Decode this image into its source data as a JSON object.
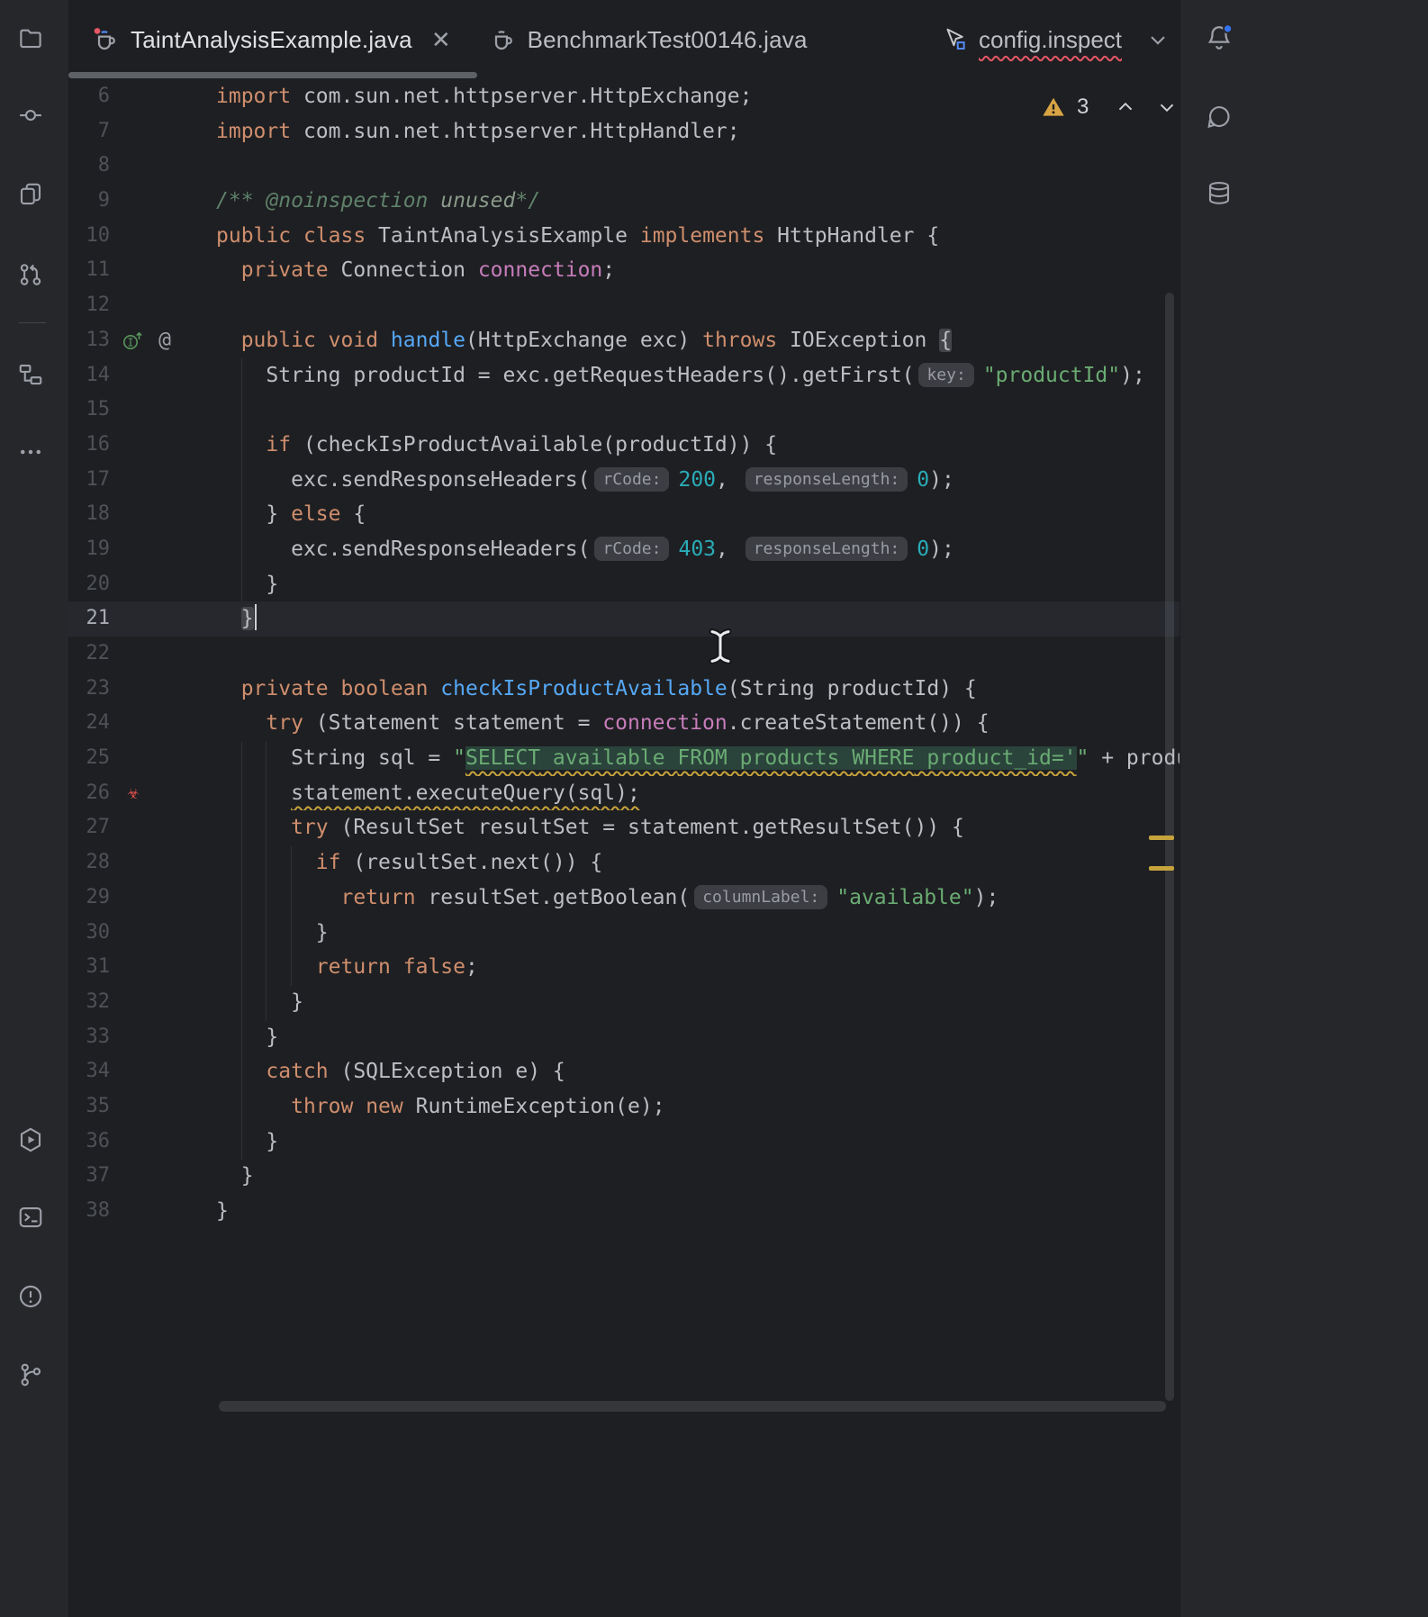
{
  "colors": {
    "editor_bg": "#1E1F22",
    "stripe_bg": "#26272B",
    "accent_blue": "#3574F0",
    "warning_yellow": "#D8A444",
    "error_red": "#E55765",
    "keyword_orange": "#CF8E6D",
    "string_green": "#6AAB73",
    "number_teal": "#2AACB8",
    "method_blue": "#56A8F5",
    "field_purple": "#C77DBB",
    "comment_green": "#5F826B",
    "sql_injection_bg": "#396F5C",
    "current_line_bg": "#26282E"
  },
  "left_stripe": {
    "top_icons": [
      {
        "name": "project-folder"
      },
      {
        "name": "commit"
      },
      {
        "name": "copy-pages"
      },
      {
        "name": "pull-requests"
      },
      {
        "name": "structure"
      },
      {
        "name": "more-tools"
      }
    ],
    "bottom_icons": [
      {
        "name": "run-services"
      },
      {
        "name": "terminal"
      },
      {
        "name": "problems"
      },
      {
        "name": "git-branch"
      }
    ]
  },
  "right_stripe": {
    "icons": [
      {
        "name": "notifications-bell",
        "has_new": true
      },
      {
        "name": "ai-assistant"
      },
      {
        "name": "database"
      }
    ]
  },
  "tab_bar": {
    "tabs": [
      {
        "title": "TaintAnalysisExample.java",
        "active": true,
        "icon": "java-file",
        "close_glyph": "✕"
      },
      {
        "title": "BenchmarkTest00146.java",
        "active": false,
        "icon": "java-file"
      }
    ],
    "overflow": {
      "icon": "inspection-config-file",
      "title": "config.inspect",
      "has_error_underline": true
    }
  },
  "inspection_widget": {
    "warning_count": "3",
    "icons": [
      "warning-triangle",
      "chevron-up",
      "chevron-down"
    ]
  },
  "editor": {
    "first_line": 6,
    "last_line": 38,
    "current_line": 21,
    "lines": [
      {
        "n": 6,
        "ind": 0,
        "tk": [
          [
            "kw",
            "import"
          ],
          [
            "pl",
            " com.sun.net.httpserver.HttpExchange;"
          ]
        ]
      },
      {
        "n": 7,
        "ind": 0,
        "tk": [
          [
            "kw",
            "import"
          ],
          [
            "pl",
            " com.sun.net.httpserver.HttpHandler;"
          ]
        ]
      },
      {
        "n": 8,
        "ind": 0,
        "tk": []
      },
      {
        "n": 9,
        "ind": 0,
        "tk": [
          [
            "doc",
            "/** @noinspection "
          ],
          [
            "docv",
            "unused"
          ],
          [
            "doc",
            "*/"
          ]
        ]
      },
      {
        "n": 10,
        "ind": 0,
        "tk": [
          [
            "kw",
            "public"
          ],
          [
            "pl",
            " "
          ],
          [
            "kw",
            "class"
          ],
          [
            "pl",
            " TaintAnalysisExample "
          ],
          [
            "kw",
            "implements"
          ],
          [
            "pl",
            " HttpHandler {"
          ]
        ]
      },
      {
        "n": 11,
        "ind": 2,
        "tk": [
          [
            "kw",
            "private"
          ],
          [
            "pl",
            " Connection "
          ],
          [
            "fld",
            "connection"
          ],
          [
            "pl",
            ";"
          ]
        ]
      },
      {
        "n": 12,
        "ind": 0,
        "tk": []
      },
      {
        "n": 13,
        "ind": 2,
        "g": [
          "impl",
          "at"
        ],
        "tk": [
          [
            "kw",
            "public"
          ],
          [
            "pl",
            " "
          ],
          [
            "kw",
            "void"
          ],
          [
            "pl",
            " "
          ],
          [
            "mth",
            "handle"
          ],
          [
            "pl",
            "(HttpExchange exc) "
          ],
          [
            "kw",
            "throws"
          ],
          [
            "pl",
            " IOException "
          ],
          [
            "pl",
            "{",
            "bm"
          ]
        ]
      },
      {
        "n": 14,
        "ind": 4,
        "tk": [
          [
            "pl",
            "String productId = exc.getRequestHeaders().getFirst("
          ],
          [
            "inlay",
            "key:"
          ],
          [
            "str",
            "\"productId\""
          ],
          [
            "pl",
            ");"
          ]
        ]
      },
      {
        "n": 15,
        "ind": 0,
        "tk": []
      },
      {
        "n": 16,
        "ind": 4,
        "tk": [
          [
            "kw",
            "if"
          ],
          [
            "pl",
            " (checkIsProductAvailable(productId)) {"
          ]
        ]
      },
      {
        "n": 17,
        "ind": 6,
        "tk": [
          [
            "pl",
            "exc.sendResponseHeaders("
          ],
          [
            "inlay",
            "rCode:"
          ],
          [
            "num",
            "200"
          ],
          [
            "pl",
            ", "
          ],
          [
            "inlay",
            "responseLength:"
          ],
          [
            "num",
            "0"
          ],
          [
            "pl",
            ");"
          ]
        ]
      },
      {
        "n": 18,
        "ind": 4,
        "tk": [
          [
            "pl",
            "} "
          ],
          [
            "kw",
            "else"
          ],
          [
            "pl",
            " {"
          ]
        ]
      },
      {
        "n": 19,
        "ind": 6,
        "tk": [
          [
            "pl",
            "exc.sendResponseHeaders("
          ],
          [
            "inlay",
            "rCode:"
          ],
          [
            "num",
            "403"
          ],
          [
            "pl",
            ", "
          ],
          [
            "inlay",
            "responseLength:"
          ],
          [
            "num",
            "0"
          ],
          [
            "pl",
            ");"
          ]
        ]
      },
      {
        "n": 20,
        "ind": 4,
        "tk": [
          [
            "pl",
            "}"
          ]
        ]
      },
      {
        "n": 21,
        "ind": 2,
        "cur": true,
        "caret": true,
        "tk": [
          [
            "pl",
            "}",
            "bm"
          ]
        ]
      },
      {
        "n": 22,
        "ind": 0,
        "tk": []
      },
      {
        "n": 23,
        "ind": 2,
        "tk": [
          [
            "kw",
            "private"
          ],
          [
            "pl",
            " "
          ],
          [
            "kw",
            "boolean"
          ],
          [
            "pl",
            " "
          ],
          [
            "mth",
            "checkIsProductAvailable"
          ],
          [
            "pl",
            "(String productId) {"
          ]
        ]
      },
      {
        "n": 24,
        "ind": 4,
        "tk": [
          [
            "kw",
            "try"
          ],
          [
            "pl",
            " (Statement statement = "
          ],
          [
            "fld",
            "connection"
          ],
          [
            "pl",
            ".createStatement()) {"
          ]
        ]
      },
      {
        "n": 25,
        "ind": 6,
        "tk": [
          [
            "pl",
            "String sql = "
          ],
          [
            "str",
            "\""
          ],
          [
            "sqlk",
            "SELECT",
            "sqlbg wavy"
          ],
          [
            "sqls",
            " available ",
            "sqlbg wavy"
          ],
          [
            "sqlk",
            "FROM",
            "sqlbg wavy"
          ],
          [
            "sqls",
            " products ",
            "sqlbg wavy"
          ],
          [
            "sqlk",
            "WHERE",
            "sqlbg wavy"
          ],
          [
            "sqls",
            " product_id='",
            "sqlbg wavy"
          ],
          [
            "str",
            "\""
          ],
          [
            "pl",
            " + productId + "
          ],
          [
            "str",
            "\"'\""
          ],
          [
            "pl",
            ";"
          ]
        ]
      },
      {
        "n": 26,
        "ind": 6,
        "g": [
          "taint"
        ],
        "tk": [
          [
            "pl",
            "statement.executeQuery(sql);",
            "wavy"
          ]
        ]
      },
      {
        "n": 27,
        "ind": 6,
        "tk": [
          [
            "kw",
            "try"
          ],
          [
            "pl",
            " (ResultSet resultSet = statement.getResultSet()) {"
          ]
        ]
      },
      {
        "n": 28,
        "ind": 8,
        "tk": [
          [
            "kw",
            "if"
          ],
          [
            "pl",
            " (resultSet.next()) {"
          ]
        ]
      },
      {
        "n": 29,
        "ind": 10,
        "tk": [
          [
            "kw",
            "return"
          ],
          [
            "pl",
            " resultSet.getBoolean("
          ],
          [
            "inlay",
            "columnLabel:"
          ],
          [
            "str",
            "\"available\""
          ],
          [
            "pl",
            ");"
          ]
        ]
      },
      {
        "n": 30,
        "ind": 8,
        "tk": [
          [
            "pl",
            "}"
          ]
        ]
      },
      {
        "n": 31,
        "ind": 8,
        "tk": [
          [
            "kw",
            "return"
          ],
          [
            "pl",
            " "
          ],
          [
            "kw",
            "false"
          ],
          [
            "pl",
            ";"
          ]
        ]
      },
      {
        "n": 32,
        "ind": 6,
        "tk": [
          [
            "pl",
            "}"
          ]
        ]
      },
      {
        "n": 33,
        "ind": 4,
        "tk": [
          [
            "pl",
            "}"
          ]
        ]
      },
      {
        "n": 34,
        "ind": 4,
        "tk": [
          [
            "kw",
            "catch"
          ],
          [
            "pl",
            " (SQLException e) {"
          ]
        ]
      },
      {
        "n": 35,
        "ind": 6,
        "tk": [
          [
            "kw",
            "throw"
          ],
          [
            "pl",
            " "
          ],
          [
            "kw",
            "new"
          ],
          [
            "pl",
            " RuntimeException(e);"
          ]
        ]
      },
      {
        "n": 36,
        "ind": 4,
        "tk": [
          [
            "pl",
            "}"
          ]
        ]
      },
      {
        "n": 37,
        "ind": 2,
        "tk": [
          [
            "pl",
            "}"
          ]
        ]
      },
      {
        "n": 38,
        "ind": 0,
        "tk": [
          [
            "pl",
            "}"
          ]
        ]
      }
    ]
  }
}
